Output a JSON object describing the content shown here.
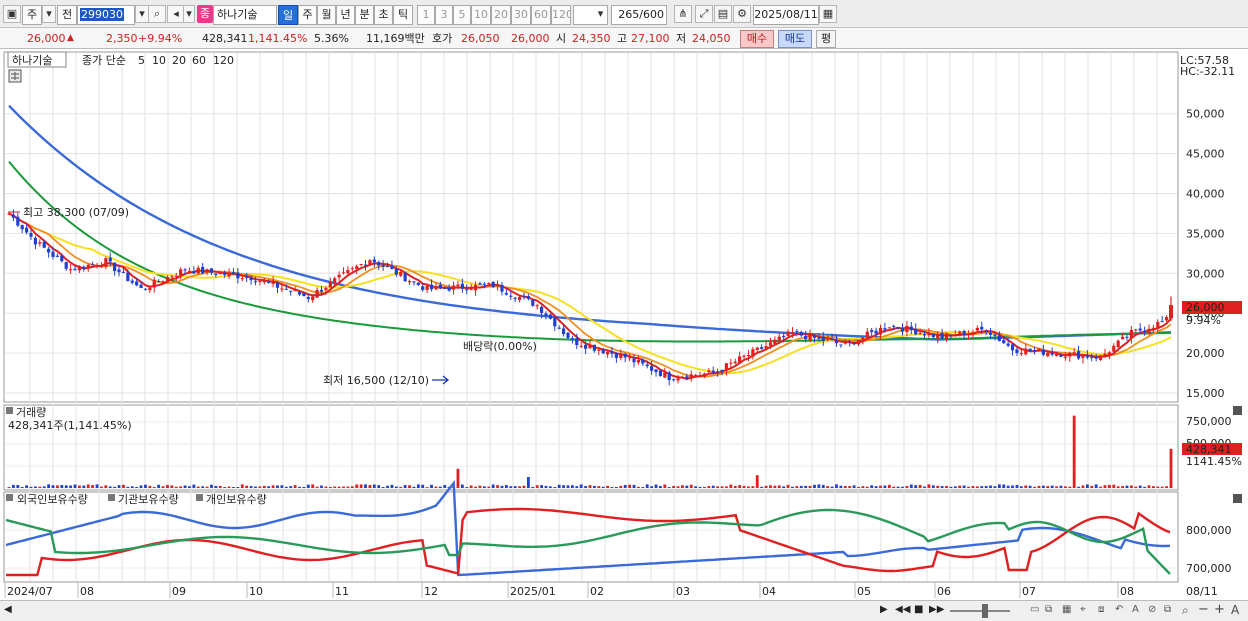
{
  "toolbar": {
    "market": "주",
    "period_code": "전",
    "stock_code": "299030",
    "type_badge": "종",
    "stock_name": "하나기술",
    "period_buttons": [
      "일",
      "주",
      "월",
      "년",
      "분",
      "초",
      "틱"
    ],
    "interval_buttons": [
      "1",
      "3",
      "5",
      "10",
      "20",
      "30",
      "60",
      "120"
    ],
    "count_value": "265",
    "count_total": "/600",
    "date_value": "2025/08/11"
  },
  "quote": {
    "price": "26,000",
    "change_arrow": "▲",
    "change": "2,350",
    "change_pct": "+9.94%",
    "volume": "428,341",
    "volume_pct": "1,141.45%",
    "turnover_pct": "5.36%",
    "trade_amount": "11,169백만",
    "ask_label": "호가",
    "ask1": "26,050",
    "ask2": "26,000",
    "open_label": "시",
    "open": "24,350",
    "high_label": "고",
    "high": "27,100",
    "low_label": "저",
    "low": "24,050",
    "buy_label": "매수",
    "sell_label": "매도",
    "eval_label": "평"
  },
  "price_pane": {
    "stock_label": "하나기술",
    "ma_title": "종가 단순",
    "ma": [
      {
        "period": "5",
        "color": "#e03020"
      },
      {
        "period": "10",
        "color": "#f0a020"
      },
      {
        "period": "20",
        "color": "#f0e020"
      },
      {
        "period": "60",
        "color": "#1a9a3a"
      },
      {
        "period": "120",
        "color": "#3a6ad8"
      }
    ],
    "lc_label": "LC:57.58",
    "hc_label": "HC:-32.11",
    "high_annotation": "최고 38,300 (07/09)",
    "low_annotation": "최저 16,500 (12/10)",
    "dividend_annotation": "배당락(0.00%)",
    "y_ticks": [
      "50,000",
      "45,000",
      "40,000",
      "35,000",
      "30,000",
      "25,000",
      "20,000",
      "15,000"
    ],
    "last_price_tag": "26,000",
    "last_pct_tag": "9.94%"
  },
  "volume_pane": {
    "title": "거래량",
    "value_label": "428,341주(1,141.45%)",
    "y_ticks": [
      "750,000",
      "500,000"
    ],
    "last_volume_tag": "428,341",
    "last_volume_pct": "1141.45%"
  },
  "holdings_pane": {
    "series": [
      {
        "name": "외국인보유수량",
        "color": "#e02020"
      },
      {
        "name": "기관보유수량",
        "color": "#3a6ad8"
      },
      {
        "name": "개인보유수량",
        "color": "#2a9a5a"
      }
    ],
    "y_ticks": [
      "800,000",
      "700,000"
    ]
  },
  "x_axis": [
    "2024/07",
    "08",
    "09",
    "10",
    "11",
    "12",
    "2025/01",
    "02",
    "03",
    "04",
    "05",
    "06",
    "07",
    "08"
  ],
  "x_axis_right": "08/11",
  "colors": {
    "up": "#e02020",
    "down": "#2040d0",
    "accent": "#c02020"
  },
  "chart_data": {
    "type": "candlestick",
    "title": "하나기술 일봉",
    "x_range": [
      "2024/07",
      "2025/08/11"
    ],
    "price_range": [
      15000,
      57580
    ],
    "ohlc_last": {
      "open": 24350,
      "high": 27100,
      "low": 24050,
      "close": 26000
    },
    "annotations": [
      {
        "label": "최고",
        "value": 38300,
        "date": "07/09"
      },
      {
        "label": "최저",
        "value": 16500,
        "date": "12/10"
      }
    ],
    "volume_last": 428341
  }
}
